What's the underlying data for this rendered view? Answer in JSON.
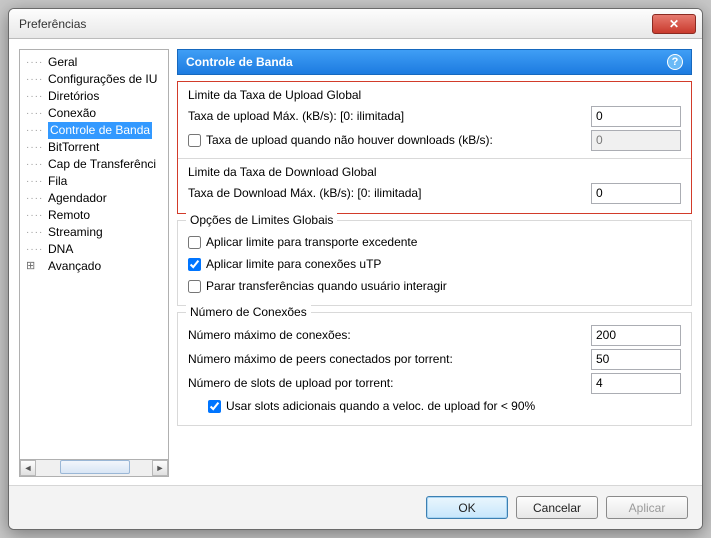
{
  "window": {
    "title": "Preferências"
  },
  "tree": {
    "items": [
      {
        "label": "Geral"
      },
      {
        "label": "Configurações de IU"
      },
      {
        "label": "Diretórios"
      },
      {
        "label": "Conexão"
      },
      {
        "label": "Controle de Banda",
        "selected": true
      },
      {
        "label": "BitTorrent"
      },
      {
        "label": "Cap de Transferênci"
      },
      {
        "label": "Fila"
      },
      {
        "label": "Agendador"
      },
      {
        "label": "Remoto"
      },
      {
        "label": "Streaming"
      },
      {
        "label": "DNA"
      },
      {
        "label": "Avançado",
        "expandable": true
      }
    ]
  },
  "panel": {
    "title": "Controle de Banda"
  },
  "upload": {
    "legend": "Limite da Taxa de Upload Global",
    "rate_label": "Taxa de upload Máx. (kB/s): [0: ilimitada]",
    "rate_value": "0",
    "alt_label": "Taxa de upload quando não houver downloads (kB/s):",
    "alt_checked": false,
    "alt_value": "0"
  },
  "download": {
    "legend": "Limite da Taxa de Download Global",
    "rate_label": "Taxa de Download Máx. (kB/s): [0: ilimitada]",
    "rate_value": "0"
  },
  "globals": {
    "legend": "Opções de Limites Globais",
    "opt1_label": "Aplicar limite para transporte excedente",
    "opt1_checked": false,
    "opt2_label": "Aplicar limite para conexões uTP",
    "opt2_checked": true,
    "opt3_label": "Parar transferências quando usuário interagir",
    "opt3_checked": false
  },
  "conn": {
    "legend": "Número de Conexões",
    "max_conn_label": "Número máximo de conexões:",
    "max_conn_value": "200",
    "max_peers_label": "Número máximo de peers conectados por torrent:",
    "max_peers_value": "50",
    "upload_slots_label": "Número de slots de upload por torrent:",
    "upload_slots_value": "4",
    "extra_slots_label": "Usar slots adicionais quando a veloc. de upload for < 90%",
    "extra_slots_checked": true
  },
  "buttons": {
    "ok": "OK",
    "cancel": "Cancelar",
    "apply": "Aplicar"
  }
}
